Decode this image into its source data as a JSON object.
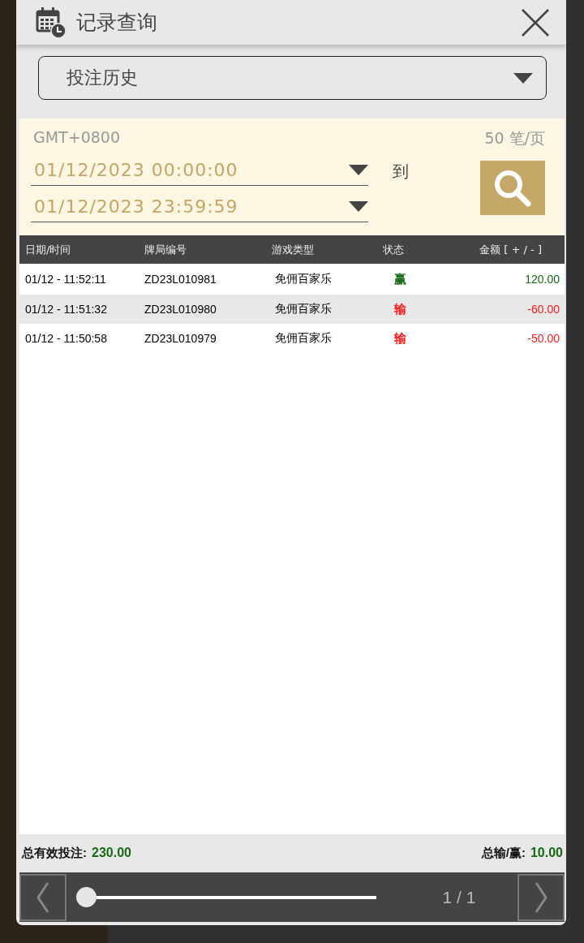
{
  "dialog": {
    "title": "记录查询"
  },
  "record_type": {
    "value": "投注历史"
  },
  "filter": {
    "timezone": "GMT+0800",
    "page_size": "50 笔/页",
    "start": "01/12/2023 00:00:00",
    "separator": "到",
    "end": "01/12/2023 23:59:59"
  },
  "table": {
    "columns": [
      "日期/时间",
      "牌局编号",
      "游戏类型",
      "状态",
      "金额 [ + / - ]"
    ],
    "rows": [
      {
        "time": "01/12 - 11:52:11",
        "round": "ZD23L010981",
        "game": "免佣百家乐",
        "status": "赢",
        "color": "#156b12",
        "amount": "120.00"
      },
      {
        "time": "01/12 - 11:51:32",
        "round": "ZD23L010980",
        "game": "免佣百家乐",
        "status": "输",
        "color": "#ff1a1a",
        "amount": "-60.00"
      },
      {
        "time": "01/12 - 11:50:58",
        "round": "ZD23L010979",
        "game": "免佣百家乐",
        "status": "输",
        "color": "#ff1a1a",
        "amount": "-50.00"
      }
    ]
  },
  "totals": {
    "bet_label": "总有效投注:",
    "bet_value": "230.00",
    "net_label": "总输/赢:",
    "net_value": "10.00"
  },
  "pager": {
    "level": 0,
    "page": "1 / 1"
  }
}
